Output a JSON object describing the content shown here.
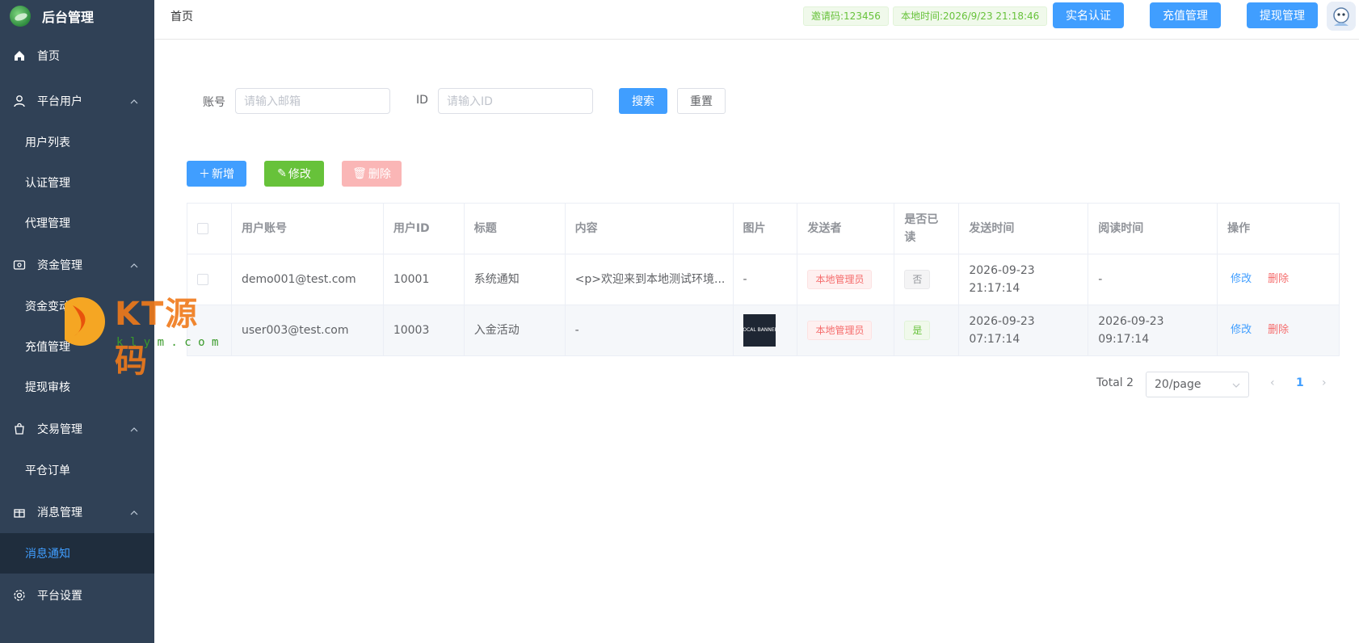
{
  "sidebar": {
    "title": "后台管理",
    "items": [
      {
        "label": "首页",
        "icon": "home-icon"
      },
      {
        "label": "平台用户",
        "icon": "user-icon"
      },
      {
        "label": "用户列表"
      },
      {
        "label": "认证管理"
      },
      {
        "label": "代理管理"
      },
      {
        "label": "资金管理",
        "icon": "wallet-icon"
      },
      {
        "label": "资金变动"
      },
      {
        "label": "充值管理"
      },
      {
        "label": "提现审核"
      },
      {
        "label": "交易管理",
        "icon": "bag-icon"
      },
      {
        "label": "平仓订单"
      },
      {
        "label": "消息管理",
        "icon": "gift-icon"
      },
      {
        "label": "消息通知"
      },
      {
        "label": "平台设置",
        "icon": "gear-icon"
      }
    ]
  },
  "header": {
    "breadcrumb": "首页",
    "invite_code": "邀请码:123456",
    "local_time": "本地时间:2026/9/23 21:18:46",
    "btn_realname": "实名认证",
    "btn_recharge": "充值管理",
    "btn_withdraw": "提现管理"
  },
  "search": {
    "account_label": "账号",
    "account_placeholder": "请输入邮箱",
    "id_label": "ID",
    "id_placeholder": "请输入ID",
    "search_btn": "搜索",
    "reset_btn": "重置"
  },
  "toolbar": {
    "add": "新增",
    "edit": "修改",
    "delete": "删除"
  },
  "table": {
    "columns": [
      "用户账号",
      "用户ID",
      "标题",
      "内容",
      "图片",
      "发送者",
      "是否已读",
      "发送时间",
      "阅读时间",
      "操作"
    ],
    "rows": [
      {
        "account": "demo001@test.com",
        "user_id": "10001",
        "title": "系统通知",
        "content": "<p>欢迎来到本地测试环境...",
        "image": "-",
        "sender": "本地管理员",
        "read": "否",
        "send_date": "2026-09-23",
        "send_time": "21:17:14",
        "read_date": "-",
        "read_time": "",
        "op_edit": "修改",
        "op_delete": "删除"
      },
      {
        "account": "user003@test.com",
        "user_id": "10003",
        "title": "入金活动",
        "content": "-",
        "image_text": "LOCAL BANNER",
        "sender": "本地管理员",
        "read": "是",
        "send_date": "2026-09-23",
        "send_time": "07:17:14",
        "read_date": "2026-09-23",
        "read_time": "09:17:14",
        "op_edit": "修改",
        "op_delete": "删除"
      }
    ]
  },
  "pagination": {
    "total": "Total 2",
    "page_size": "20/page",
    "current": "1"
  },
  "watermark": {
    "brand": "KT源码",
    "domain": "k l y m . c o m"
  },
  "colors": {
    "sidebar_bg": "#304156",
    "primary": "#409eff",
    "success": "#67c23a",
    "danger": "#f56c6c"
  }
}
